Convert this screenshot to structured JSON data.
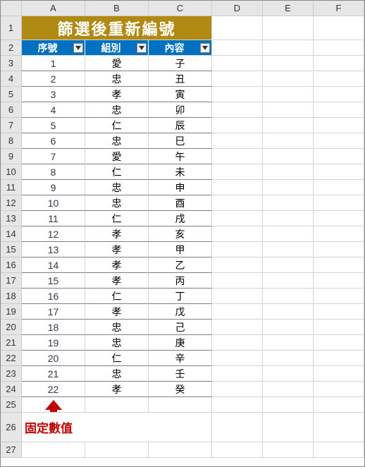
{
  "columns": [
    "A",
    "B",
    "C",
    "D",
    "E",
    "F"
  ],
  "title": "篩選後重新編號",
  "headers": {
    "a": "序號",
    "b": "組別",
    "c": "內容"
  },
  "chart_data": {
    "type": "table",
    "title": "篩選後重新編號",
    "columns": [
      "序號",
      "組別",
      "內容"
    ],
    "rows": [
      [
        1,
        "愛",
        "子"
      ],
      [
        2,
        "忠",
        "丑"
      ],
      [
        3,
        "孝",
        "寅"
      ],
      [
        4,
        "忠",
        "卯"
      ],
      [
        5,
        "仁",
        "辰"
      ],
      [
        6,
        "忠",
        "巳"
      ],
      [
        7,
        "愛",
        "午"
      ],
      [
        8,
        "仁",
        "未"
      ],
      [
        9,
        "忠",
        "申"
      ],
      [
        10,
        "忠",
        "酉"
      ],
      [
        11,
        "仁",
        "戌"
      ],
      [
        12,
        "孝",
        "亥"
      ],
      [
        13,
        "孝",
        "甲"
      ],
      [
        14,
        "孝",
        "乙"
      ],
      [
        15,
        "孝",
        "丙"
      ],
      [
        16,
        "仁",
        "丁"
      ],
      [
        17,
        "孝",
        "戊"
      ],
      [
        18,
        "忠",
        "己"
      ],
      [
        19,
        "忠",
        "庚"
      ],
      [
        20,
        "仁",
        "辛"
      ],
      [
        21,
        "忠",
        "壬"
      ],
      [
        22,
        "孝",
        "癸"
      ]
    ]
  },
  "annotation": "固定數值",
  "row_labels_extra": [
    25,
    26,
    27
  ]
}
